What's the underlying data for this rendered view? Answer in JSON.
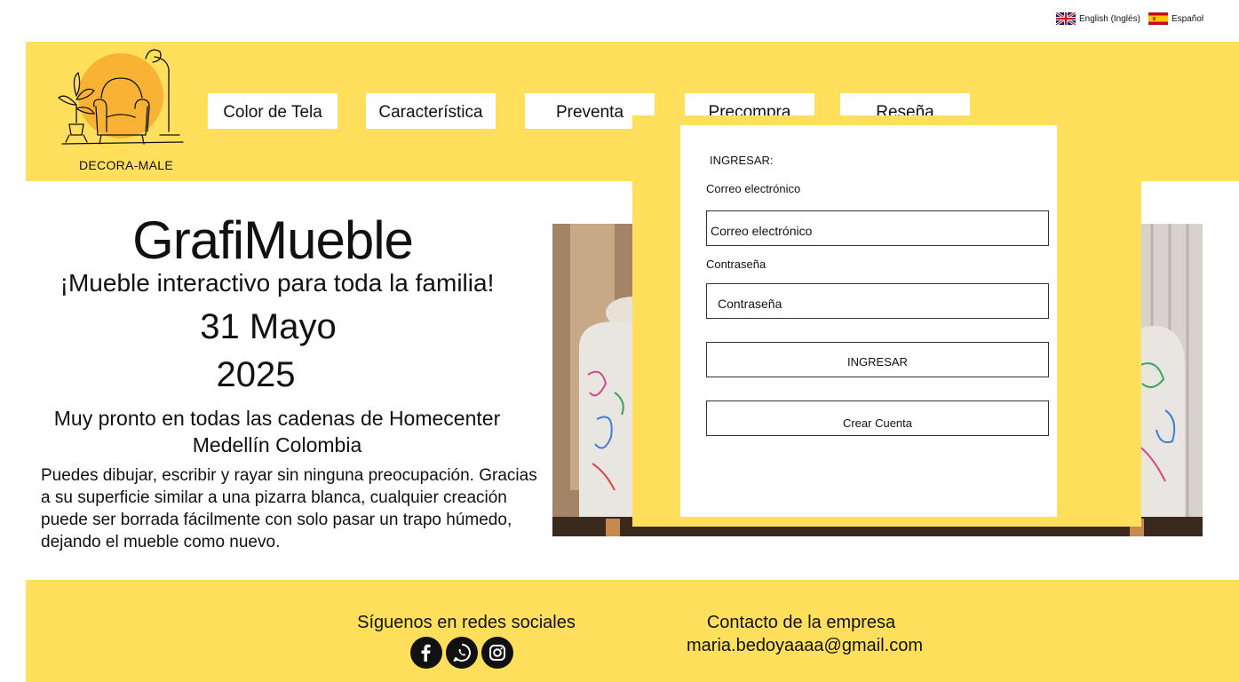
{
  "languages": {
    "english_label": "English (Inglés)",
    "spanish_label": "Español"
  },
  "brand": {
    "logo_text": "DECORA-MALE"
  },
  "nav": {
    "items": [
      {
        "label": "Color de Tela"
      },
      {
        "label": "Característica"
      },
      {
        "label": "Preventa"
      },
      {
        "label": "Precompra"
      },
      {
        "label": "Reseña"
      }
    ]
  },
  "hero": {
    "title": "GrafiMueble",
    "subtitle": "¡Mueble interactivo para toda la familia!",
    "date": "31 Mayo",
    "year": "2025",
    "soon_line1": "Muy pronto en todas las cadenas de Homecenter",
    "soon_line2": "Medellín Colombia",
    "description": "Puedes dibujar, escribir y rayar sin ninguna preocupación. Gracias a su superficie similar a una pizarra blanca, cualquier creación puede ser borrada fácilmente con solo pasar un trapo húmedo, dejando el mueble como nuevo."
  },
  "login": {
    "heading": "INGRESAR:",
    "email_label": "Correo electrónico",
    "email_placeholder": "Correo electrónico",
    "password_label": "Contraseña",
    "password_placeholder": "Contraseña",
    "submit_label": "INGRESAR",
    "create_account_label": "Crear Cuenta"
  },
  "footer": {
    "follow_label": "Síguenos en redes sociales",
    "social_icons": [
      "facebook-icon",
      "whatsapp-icon",
      "instagram-icon"
    ],
    "contact_title": "Contacto de la empresa",
    "contact_email": "maria.bedoyaaaa@gmail.com"
  },
  "colors": {
    "brand_yellow": "#ffdf5c",
    "logo_circle": "#f9b233",
    "text": "#111111"
  }
}
